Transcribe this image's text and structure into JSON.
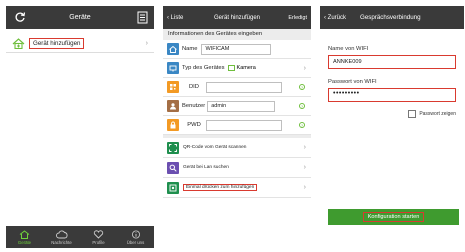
{
  "screen1": {
    "header": {
      "title": "Geräte",
      "refresh_icon": "refresh-icon",
      "menu_icon": "list-icon"
    },
    "add_device": {
      "label": "Gerät hinzufügen",
      "icon": "home-plus-icon"
    },
    "tabs": [
      {
        "label": "Geräte",
        "icon": "home-icon",
        "active": true
      },
      {
        "label": "Nachrichte",
        "icon": "cloud-icon",
        "active": false
      },
      {
        "label": "Profile",
        "icon": "heart-icon",
        "active": false
      },
      {
        "label": "Über uns",
        "icon": "info-icon",
        "active": false
      }
    ]
  },
  "screen2": {
    "header": {
      "back": "Liste",
      "title": "Gerät hinzufügen",
      "done": "Erledigt"
    },
    "section_title": "Informationen des Gerätes eingeben",
    "name": {
      "label": "Name",
      "value": "WIFICAM"
    },
    "type": {
      "label": "Typ des Gerätes",
      "option": "Kamera"
    },
    "did": {
      "label": "DID",
      "value": ""
    },
    "user": {
      "label": "Benutzer",
      "value": "admin"
    },
    "pwd": {
      "label": "PWD",
      "value": ""
    },
    "actions": {
      "qr": "QR-Code vom Gerät scannen",
      "lan": "Gerät bei Lan suchen",
      "oneclick": "Einmal drücken zum hinzufügen"
    }
  },
  "screen3": {
    "header": {
      "back": "Zurück",
      "title": "Gesprächsverbindung"
    },
    "wifi_name_label": "Name von WIFI",
    "wifi_name_value": "ANNKE009",
    "wifi_pw_label": "Passwort von WIFI",
    "wifi_pw_value": "•••••••••",
    "show_password": "Passwort zeigen",
    "start_button": "Konfiguration starten"
  },
  "colors": {
    "bar": "#3a3a3a",
    "accent_green": "#6fd33c",
    "highlight_red": "#d93a2f",
    "button_green": "#3f9b2f",
    "icon_blue": "#3a87c4"
  }
}
